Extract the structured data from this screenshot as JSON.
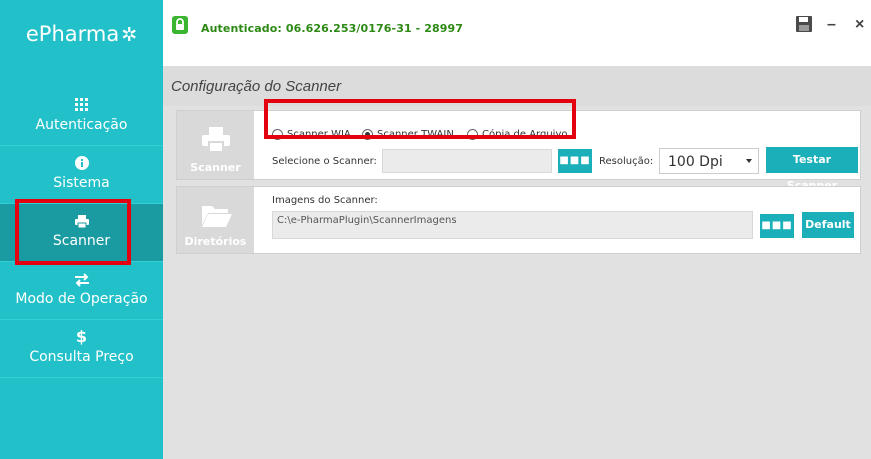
{
  "app": {
    "logo": "ePharma",
    "logo_star": "✲"
  },
  "colors": {
    "sidebar": "#22c1c9",
    "sidebar_active": "#1a9ba2",
    "accent_button": "#1bb0b9",
    "auth_green": "#2c8a14",
    "highlight": "#e3000f"
  },
  "header": {
    "auth_status": "Autenticado: 06.626.253/0176-31 - 28997",
    "icons": [
      "lock-icon",
      "save-icon",
      "minimize-icon",
      "close-icon"
    ],
    "minimize_glyph": "–",
    "close_glyph": "×"
  },
  "sidebar": {
    "items": [
      {
        "label": "Autenticação",
        "icon": "grid-icon",
        "glyph": "⠿"
      },
      {
        "label": "Sistema",
        "icon": "info-icon",
        "glyph": "ℹ"
      },
      {
        "label": "Scanner",
        "icon": "printer-icon",
        "glyph": "🖶",
        "active": true
      },
      {
        "label": "Modo de Operação",
        "icon": "swap-icon",
        "glyph": "⇄"
      },
      {
        "label": "Consulta Preço",
        "icon": "dollar-icon",
        "glyph": "$"
      }
    ]
  },
  "main": {
    "title": "Configuração do Scanner",
    "scanner_panel": {
      "side_label": "Scanner",
      "radios": [
        {
          "label": "Scanner WIA",
          "checked": false
        },
        {
          "label": "Scanner TWAIN",
          "checked": true
        },
        {
          "label": "Cópia de Arquivo",
          "checked": false
        }
      ],
      "select_scanner_label": "Selecione o Scanner:",
      "select_scanner_value": "",
      "browse_glyph": "■■■",
      "resolution_label": "Resolução:",
      "resolution_value": "100 Dpi",
      "test_button": "Testar Scanner"
    },
    "directories_panel": {
      "side_label": "Diretórios",
      "images_label": "Imagens do Scanner:",
      "path_value": "C:\\e-PharmaPlugin\\ScannerImagens",
      "browse_glyph": "■■■",
      "default_button": "Default"
    }
  }
}
